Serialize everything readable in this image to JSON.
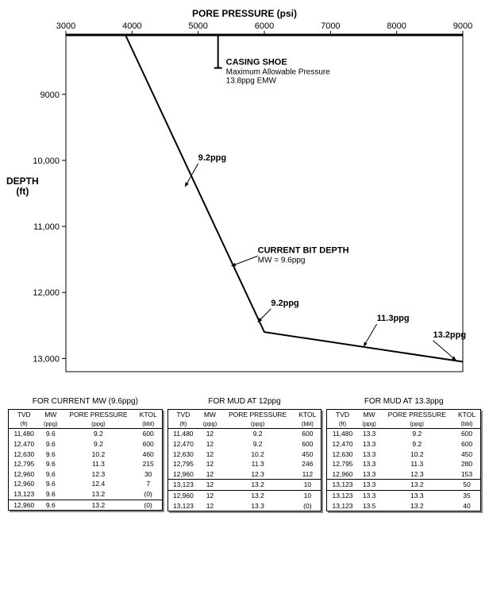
{
  "chart_data": {
    "type": "line",
    "title": "",
    "xlabel": "PORE PRESSURE (psi)",
    "ylabel": "DEPTH\n(ft)",
    "x_ticks": [
      3000,
      4000,
      5000,
      6000,
      7000,
      8000,
      9000
    ],
    "y_ticks": [
      9000,
      10000,
      11000,
      12000,
      13000
    ],
    "xlim": [
      3000,
      9000
    ],
    "ylim": [
      8100,
      13200
    ],
    "y_inverted": true,
    "series": [
      {
        "name": "pore-pressure",
        "x": [
          3900,
          6000,
          9000
        ],
        "depth": [
          8100,
          12600,
          13050
        ]
      }
    ],
    "casing_shoe": {
      "x": 5300,
      "depth_top": 8100,
      "depth_bottom": 8600,
      "label": "CASING SHOE",
      "sub1": "Maximum Allowable Pressure",
      "sub2": "13.8ppg EMW"
    },
    "annotations": [
      {
        "label": "9.2ppg",
        "tx": 5000,
        "ty": 10000,
        "ax": 4800,
        "ay": 10400
      },
      {
        "label": "CURRENT BIT DEPTH",
        "sub": "MW = 9.6ppg",
        "tx": 5900,
        "ty": 11400,
        "ax": 5500,
        "ay": 11600
      },
      {
        "label": "9.2ppg",
        "tx": 6100,
        "ty": 12200,
        "ax": 5900,
        "ay": 12450
      },
      {
        "label": "11.3ppg",
        "tx": 7700,
        "ty": 12430,
        "ax": 7500,
        "ay": 12820
      },
      {
        "label": "13.2ppg",
        "tx": 8550,
        "ty": 12680,
        "ax": 8900,
        "ay": 13030
      }
    ]
  },
  "tables": [
    {
      "title": "FOR CURRENT MW (9.6ppg)",
      "headers": [
        "TVD",
        "MW",
        "PORE PRESSURE",
        "KTOL"
      ],
      "units": [
        "(ft)",
        "(ppg)",
        "(ppg)",
        "(bbl)"
      ],
      "groups": [
        [
          [
            "11,480",
            "9.6",
            "9.2",
            "600"
          ],
          [
            "12,470",
            "9.6",
            "9.2",
            "600"
          ],
          [
            "12,630",
            "9.6",
            "10.2",
            "460"
          ],
          [
            "12,795",
            "9.6",
            "11.3",
            "215"
          ],
          [
            "12,960",
            "9.6",
            "12.3",
            "30"
          ],
          [
            "12,960",
            "9.6",
            "12.4",
            "7"
          ],
          [
            "13,123",
            "9.6",
            "13.2",
            "(0)"
          ]
        ],
        [
          [
            "12,960",
            "9.6",
            "13.2",
            "(0)"
          ]
        ]
      ]
    },
    {
      "title": "FOR MUD AT 12ppg",
      "headers": [
        "TVD",
        "MW",
        "PORE PRESSURE",
        "KTOL"
      ],
      "units": [
        "(ft)",
        "(ppg)",
        "(ppg)",
        "(bbl)"
      ],
      "groups": [
        [
          [
            "11,480",
            "12",
            "9.2",
            "600"
          ],
          [
            "12,470",
            "12",
            "9.2",
            "600"
          ],
          [
            "12,630",
            "12",
            "10.2",
            "450"
          ],
          [
            "12,795",
            "12",
            "11.3",
            "246"
          ],
          [
            "12,960",
            "12",
            "12.3",
            "112"
          ]
        ],
        [
          [
            "13,123",
            "12",
            "13.2",
            "10"
          ]
        ],
        [
          [
            "12,960",
            "12",
            "13.2",
            "10"
          ],
          [
            "13,123",
            "12",
            "13.3",
            "(0)"
          ]
        ]
      ]
    },
    {
      "title": "FOR MUD AT 13.3ppg",
      "headers": [
        "TVD",
        "MW",
        "PORE PRESSURE",
        "KTOL"
      ],
      "units": [
        "(ft)",
        "(ppg)",
        "(ppg)",
        "(bbl)"
      ],
      "groups": [
        [
          [
            "11,480",
            "13.3",
            "9.2",
            "600"
          ],
          [
            "12,470",
            "13.3",
            "9.2",
            "600"
          ],
          [
            "12,630",
            "13.3",
            "10.2",
            "450"
          ],
          [
            "12,795",
            "13.3",
            "11.3",
            "280"
          ],
          [
            "12,960",
            "13.3",
            "12.3",
            "153"
          ]
        ],
        [
          [
            "13,123",
            "13.3",
            "13.2",
            "50"
          ]
        ],
        [
          [
            "13,123",
            "13.3",
            "13.3",
            "35"
          ],
          [
            "13,123",
            "13.5",
            "13.2",
            "40"
          ]
        ]
      ]
    }
  ]
}
